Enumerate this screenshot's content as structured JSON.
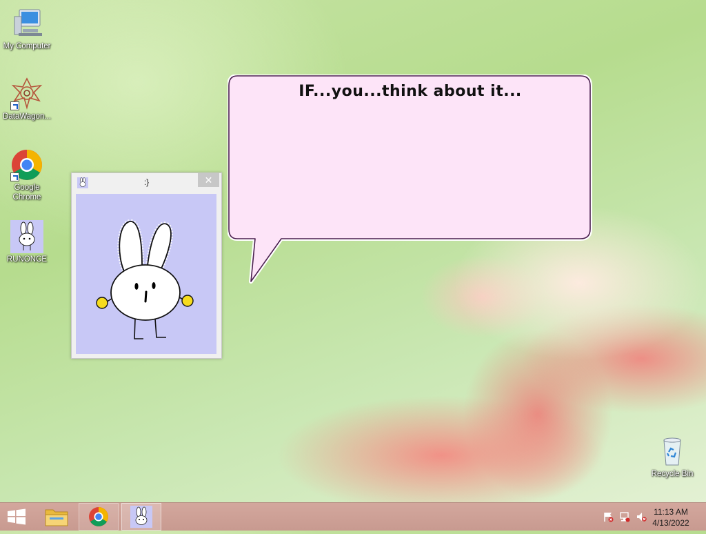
{
  "desktop": {
    "icons": [
      {
        "label": "My Computer",
        "icon": "computer-icon"
      },
      {
        "label": "DataWagon...",
        "icon": "datawagon-icon"
      },
      {
        "label": "Google Chrome",
        "icon": "chrome-icon"
      },
      {
        "label": "RUNONCE",
        "icon": "bunny-icon"
      },
      {
        "label": "Recycle Bin",
        "icon": "recycle-bin-icon"
      }
    ]
  },
  "bunny_window": {
    "title": ":}",
    "close_glyph": "✕",
    "background_color": "#c8c8f6"
  },
  "speech_bubble": {
    "text": "IF...you...think about it...",
    "fill_color": "#fde4f8"
  },
  "taskbar": {
    "items": [
      {
        "icon": "windows-start-icon"
      },
      {
        "icon": "file-explorer-icon"
      },
      {
        "icon": "chrome-icon"
      },
      {
        "icon": "bunny-icon"
      }
    ],
    "tray_icons": [
      "action-center-flag-icon",
      "network-icon",
      "volume-muted-icon"
    ],
    "clock": {
      "time": "11:13 AM",
      "date": "4/13/2022"
    }
  }
}
